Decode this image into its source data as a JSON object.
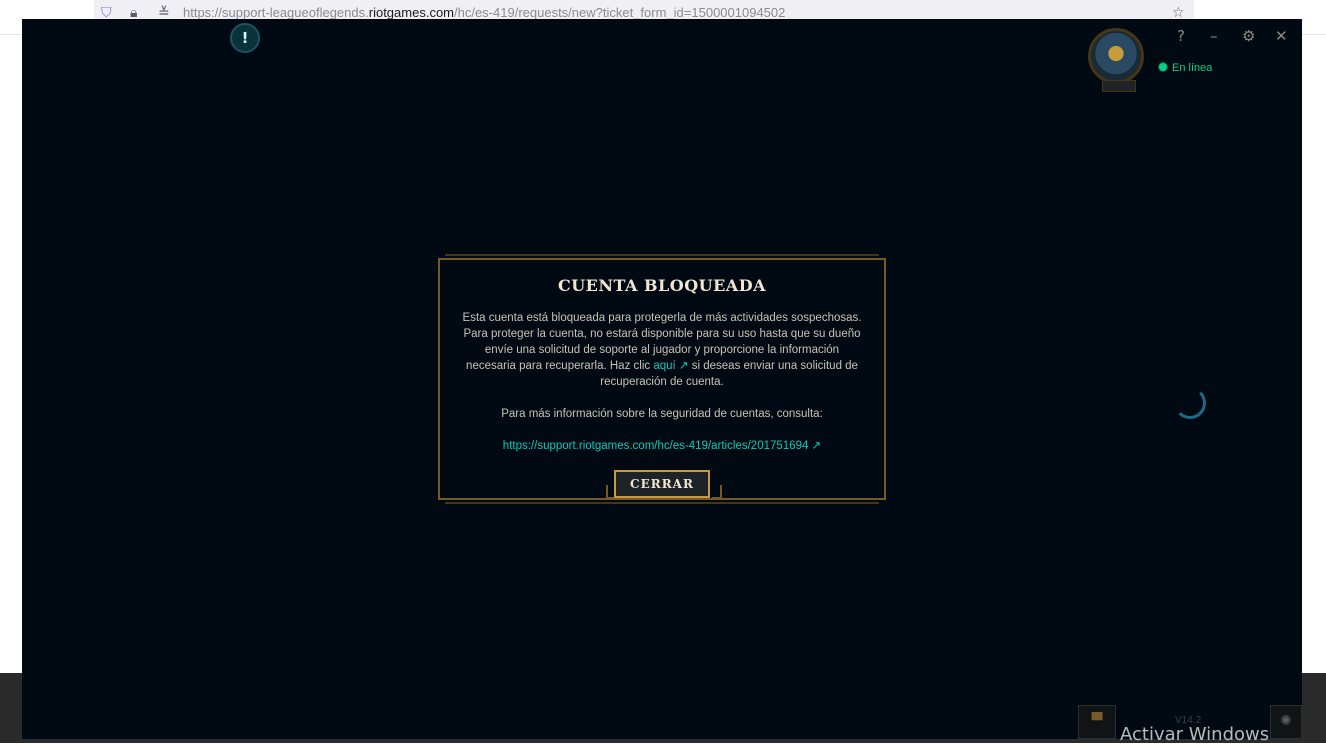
{
  "browser": {
    "url_prefix": "https://support-leagueoflegends.",
    "url_domain": "riotgames.com",
    "url_suffix": "/hc/es-419/requests/new?ticket_form_id=1500001094502"
  },
  "client": {
    "window_controls": {
      "help": "?",
      "minimize": "–",
      "settings": "⚙",
      "close": "✕"
    },
    "alert_icon": "!",
    "status_text": "En línea",
    "version": "V14.2"
  },
  "modal": {
    "title": "CUENTA BLOQUEADA",
    "body_before_link": "Esta cuenta está bloqueada para protegerla de más actividades sospechosas. Para proteger la cuenta, no estará disponible para su uso hasta que su dueño envíe una solicitud de soporte al jugador y proporcione la información necesaria para recuperarla. Haz clic ",
    "link_text": "aquí ↗",
    "body_after_link": " si deseas enviar una solicitud de recuperación de cuenta.",
    "info_text": "Para más información sobre la seguridad de cuentas, consulta:",
    "info_url": "https://support.riotgames.com/hc/es-419/articles/201751694 ↗",
    "close_button": "CERRAR"
  },
  "watermark": "Activar Windows",
  "colors": {
    "client_bg": "#010a13",
    "gold": "#c89b3c",
    "link": "#0ac8b9",
    "status_green": "#0acf83"
  }
}
